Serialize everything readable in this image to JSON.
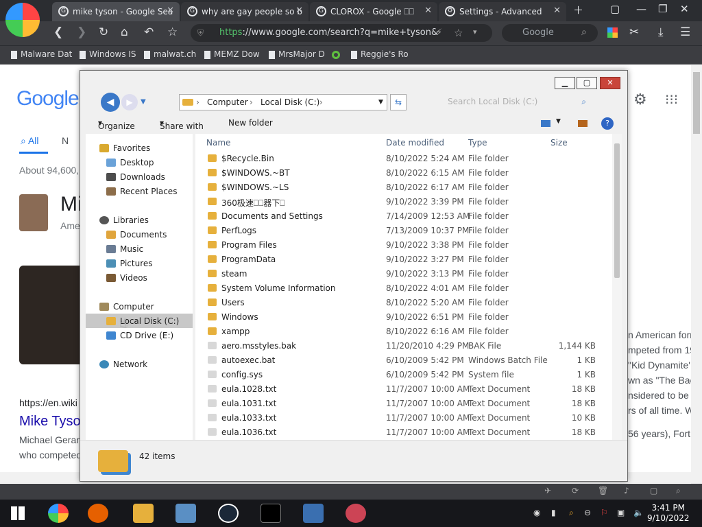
{
  "browser": {
    "tabs": [
      {
        "title": "mike tyson - Google Sea"
      },
      {
        "title": "why are gay people so b"
      },
      {
        "title": "CLOROX - Google ⎕⎕"
      },
      {
        "title": "Settings - Advanced"
      }
    ],
    "url_scheme": "https",
    "url_rest": "://www.google.com/search?q=mike+tyson&",
    "search_placeholder": "Google",
    "bookmarks": [
      "Malware Dat",
      "Windows IS",
      "malwat.ch",
      "MEMZ Dow",
      "MrsMajor D",
      "",
      "Reggie's Ro"
    ]
  },
  "google": {
    "logo": "Google",
    "tab_all": "All",
    "tab_n": "N",
    "results_count": "About 94,600,",
    "title_mi": "Mi",
    "ame": "Ame",
    "cite": "https://en.wiki",
    "link": "Mike Tyso",
    "snip1": "Michael Geran",
    "snip2": "who competed",
    "right_text": [
      "n American forn",
      "mpeted from 19",
      "\"Kid Dynamite'",
      "wn as \"The Bac",
      "nsidered to be",
      "rs of all time. W"
    ],
    "right_bottom": "56 years), Fort"
  },
  "explorer": {
    "breadcrumb": [
      "Computer",
      "Local Disk (C:)"
    ],
    "search_placeholder": "Search Local Disk (C:)",
    "toolbar": {
      "organize": "Organize",
      "share_with": "Share with",
      "new_folder": "New folder"
    },
    "nav": {
      "favorites": "Favorites",
      "desktop": "Desktop",
      "downloads": "Downloads",
      "recent": "Recent Places",
      "libraries": "Libraries",
      "documents": "Documents",
      "music": "Music",
      "pictures": "Pictures",
      "videos": "Videos",
      "computer": "Computer",
      "local_disk": "Local Disk (C:)",
      "cd_drive": "CD Drive (E:)",
      "network": "Network"
    },
    "columns": {
      "name": "Name",
      "date": "Date modified",
      "type": "Type",
      "size": "Size"
    },
    "rows": [
      {
        "name": "$Recycle.Bin",
        "date": "8/10/2022 5:24 AM",
        "type": "File folder",
        "size": ""
      },
      {
        "name": "$WINDOWS.~BT",
        "date": "8/10/2022 6:15 AM",
        "type": "File folder",
        "size": ""
      },
      {
        "name": "$WINDOWS.~LS",
        "date": "8/10/2022 6:17 AM",
        "type": "File folder",
        "size": ""
      },
      {
        "name": "360极速⎕⎕器下⎕",
        "date": "9/10/2022 3:39 PM",
        "type": "File folder",
        "size": ""
      },
      {
        "name": "Documents and Settings",
        "date": "7/14/2009 12:53 AM",
        "type": "File folder",
        "size": ""
      },
      {
        "name": "PerfLogs",
        "date": "7/13/2009 10:37 PM",
        "type": "File folder",
        "size": ""
      },
      {
        "name": "Program Files",
        "date": "9/10/2022 3:38 PM",
        "type": "File folder",
        "size": ""
      },
      {
        "name": "ProgramData",
        "date": "9/10/2022 3:27 PM",
        "type": "File folder",
        "size": ""
      },
      {
        "name": "steam",
        "date": "9/10/2022 3:13 PM",
        "type": "File folder",
        "size": ""
      },
      {
        "name": "System Volume Information",
        "date": "8/10/2022 4:01 AM",
        "type": "File folder",
        "size": ""
      },
      {
        "name": "Users",
        "date": "8/10/2022 5:20 AM",
        "type": "File folder",
        "size": ""
      },
      {
        "name": "Windows",
        "date": "9/10/2022 6:51 PM",
        "type": "File folder",
        "size": ""
      },
      {
        "name": "xampp",
        "date": "8/10/2022 6:16 AM",
        "type": "File folder",
        "size": ""
      },
      {
        "name": "aero.msstyles.bak",
        "date": "11/20/2010 4:29 PM",
        "type": "BAK File",
        "size": "1,144 KB"
      },
      {
        "name": "autoexec.bat",
        "date": "6/10/2009 5:42 PM",
        "type": "Windows Batch File",
        "size": "1 KB"
      },
      {
        "name": "config.sys",
        "date": "6/10/2009 5:42 PM",
        "type": "System file",
        "size": "1 KB"
      },
      {
        "name": "eula.1028.txt",
        "date": "11/7/2007 10:00 AM",
        "type": "Text Document",
        "size": "18 KB"
      },
      {
        "name": "eula.1031.txt",
        "date": "11/7/2007 10:00 AM",
        "type": "Text Document",
        "size": "18 KB"
      },
      {
        "name": "eula.1033.txt",
        "date": "11/7/2007 10:00 AM",
        "type": "Text Document",
        "size": "10 KB"
      },
      {
        "name": "eula.1036.txt",
        "date": "11/7/2007 10:00 AM",
        "type": "Text Document",
        "size": "18 KB"
      }
    ],
    "status": "42 items"
  },
  "taskbar": {
    "time": "3:41 PM",
    "date": "9/10/2022"
  }
}
